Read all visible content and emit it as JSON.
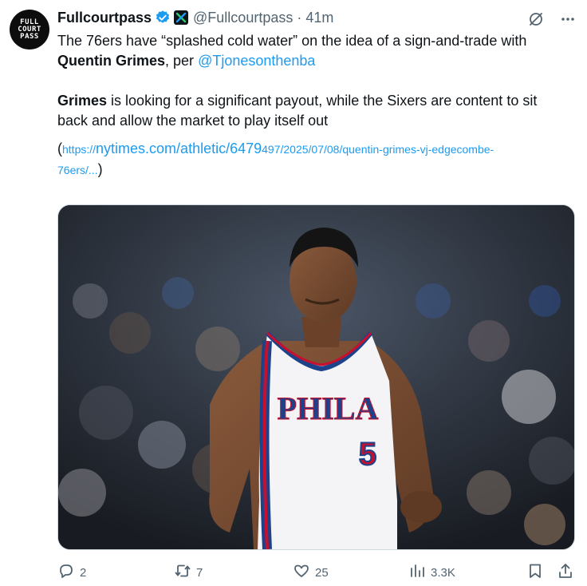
{
  "avatar": {
    "lines": [
      "FULL",
      "COURT",
      "PASS"
    ]
  },
  "author": {
    "display_name": "Fullcourtpass",
    "handle": "@Fullcourtpass",
    "separator": "·",
    "time": "41m"
  },
  "tweet": {
    "para1_a": "The 76ers have “splashed cold water” on the idea of a sign-and-trade with",
    "para1_b_bold": "Quentin Grimes",
    "para1_b_rest": ", per ",
    "mention": "@Tjonesonthenba",
    "para2_bold": "Grimes",
    "para2_rest_a": " is looking for a significant payout, while the Sixers are content to sit",
    "para2_rest_b": "back and allow the market to play itself out",
    "url_open": "(",
    "url_prefix": "https://",
    "url_main": "nytimes.com/athletic/6479",
    "url_tail1": "497/2025/07/08/quentin-grimes-vj-edgecombe-",
    "url_tail2": "76ers/...",
    "url_close": ")"
  },
  "media": {
    "jersey_text": "PHILA",
    "jersey_number": "5"
  },
  "actions": {
    "replies": "2",
    "reposts": "7",
    "likes": "25",
    "views": "3.3K"
  },
  "colors": {
    "link": "#1d9bf0",
    "muted": "#536471",
    "verified": "#1d9bf0",
    "jersey_blue": "#1d428a",
    "jersey_red": "#c8102e"
  },
  "icons": [
    "verified-badge-icon",
    "x-affiliate-icon",
    "grok-icon",
    "more-icon",
    "reply-icon",
    "repost-icon",
    "like-icon",
    "views-icon",
    "bookmark-icon",
    "share-icon"
  ]
}
